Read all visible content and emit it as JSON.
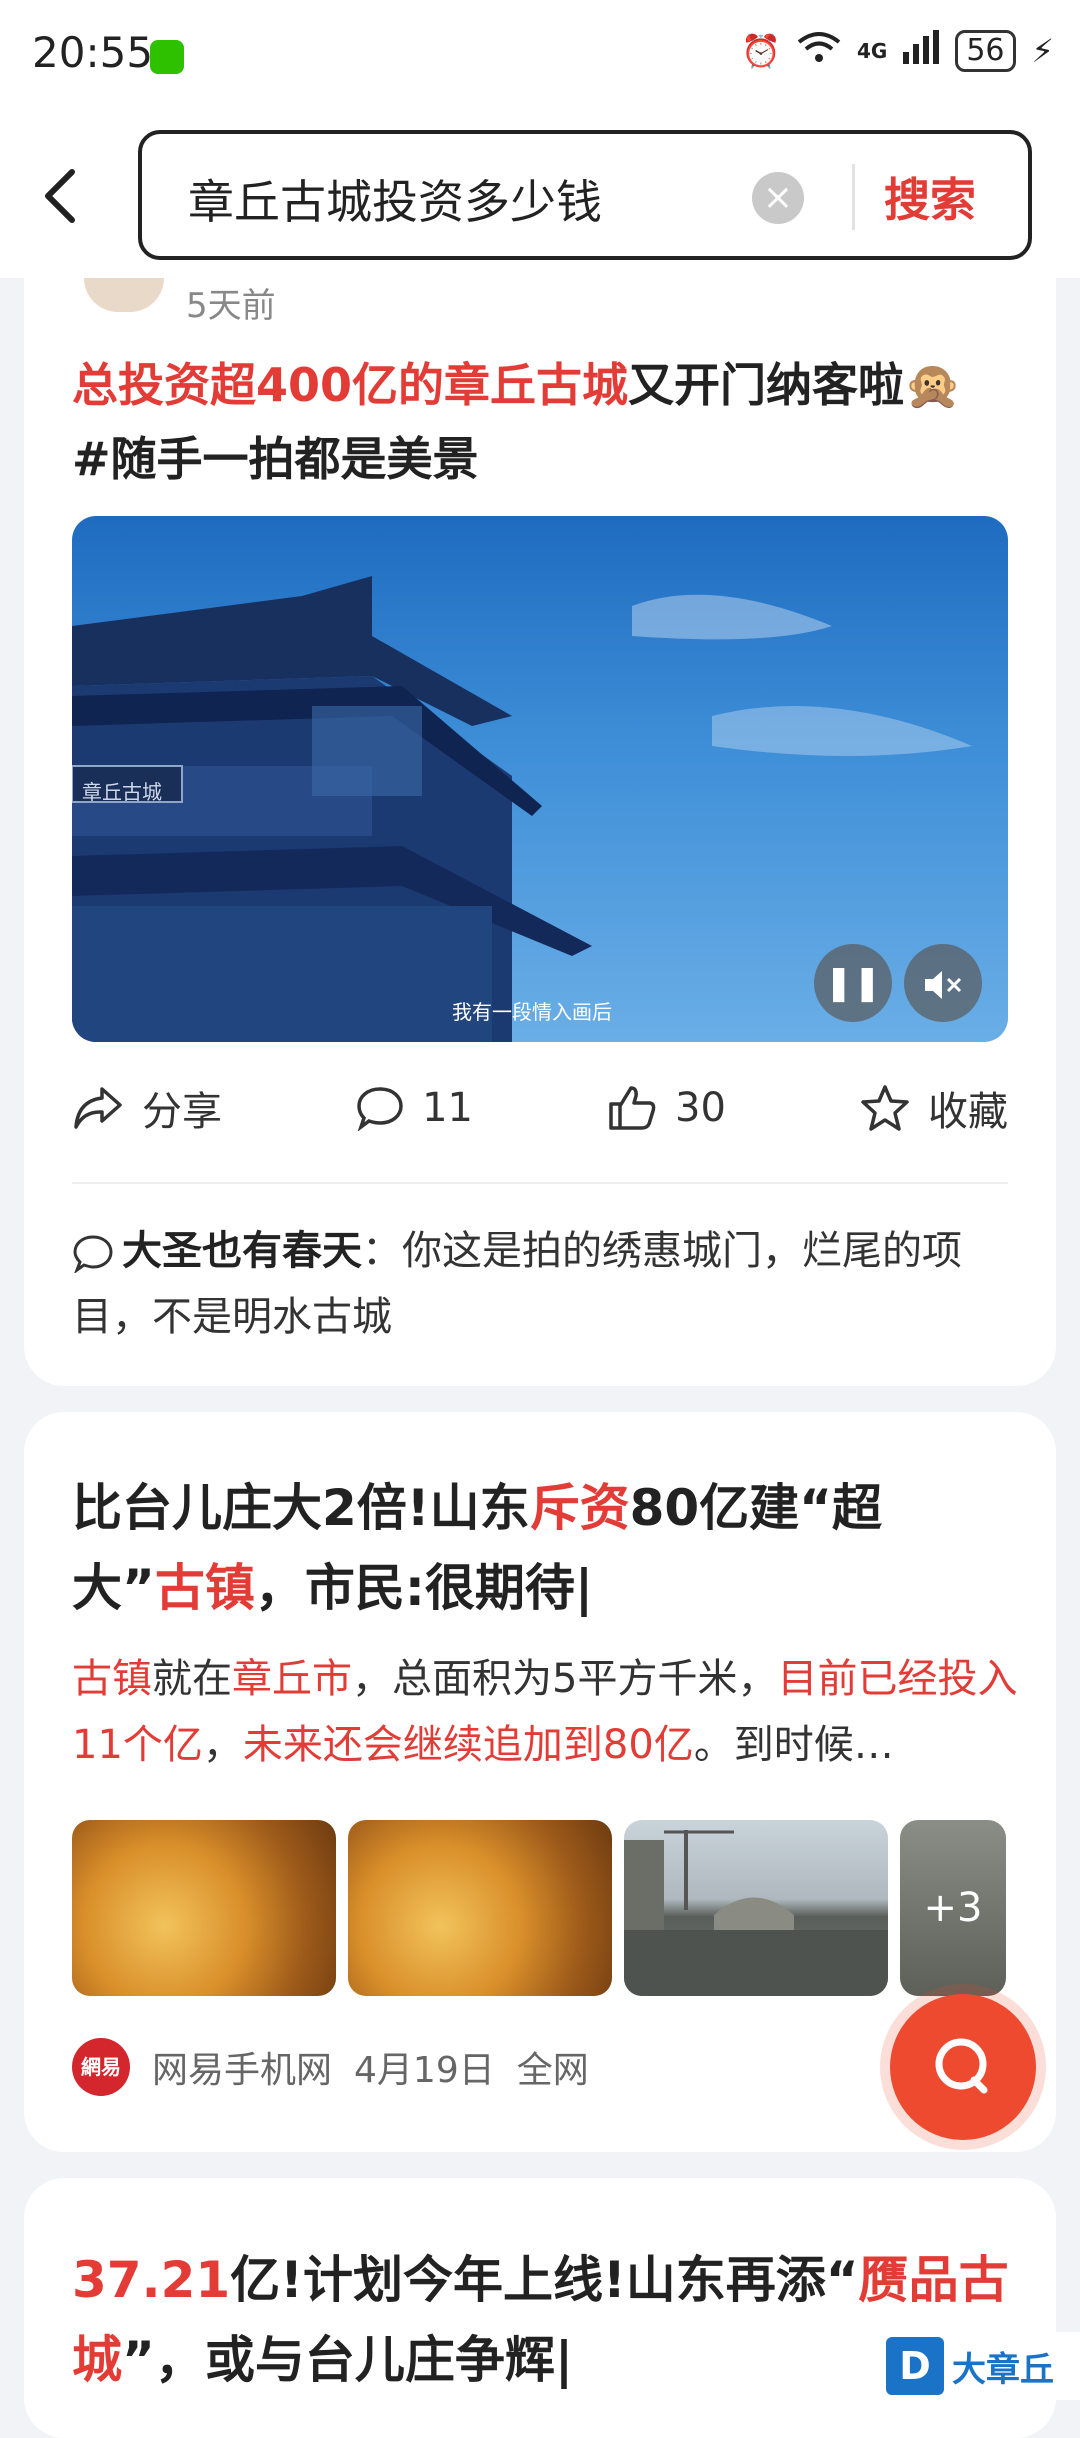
{
  "status_bar": {
    "time": "20:55",
    "network": "4G",
    "battery": "56"
  },
  "search": {
    "query": "章丘古城投资多少钱",
    "clear": "×",
    "button_label": "搜索"
  },
  "card1": {
    "time_ago": "5天前",
    "title_highlight": "总投资超400亿的章丘古城",
    "title_rest": "又开门纳客啦🙊",
    "title_line2": "#随手一拍都是美景",
    "video_caption": "我有一段情入画后",
    "video_sign": "章丘古城",
    "actions": {
      "share": "分享",
      "comments": "11",
      "likes": "30",
      "collect": "收藏"
    },
    "comment_user": "大圣也有春天",
    "comment_sep": "：",
    "comment_text": "你这是拍的绣惠城门，烂尾的项目，不是明水古城"
  },
  "card2": {
    "title_a": "比台儿庄大2倍!山东",
    "title_b": "斥资",
    "title_c": "80亿建“超大”",
    "title_d": "古镇",
    "title_e": "，市民:很期待|",
    "desc_a": "古镇",
    "desc_b": "就在",
    "desc_c": "章丘市",
    "desc_d": "，总面积为5平方千米，",
    "desc_e": "目前已经投入11个亿",
    "desc_f": "，",
    "desc_g": "未来还会继续追加到80亿",
    "desc_h": "。到时候…",
    "more_count": "+3",
    "source_logo": "網易",
    "source": "网易手机网",
    "date": "4月19日",
    "scope": "全网"
  },
  "card3": {
    "title_a": "37.21",
    "title_b": "亿!计划今年上线!山东再添“",
    "title_c": "赝品古城",
    "title_d": "”，或与台儿庄争辉|"
  },
  "watermark": {
    "logo": "D",
    "text": "大章丘"
  },
  "colors": {
    "accent": "#e33b36",
    "fab": "#ee4a2f"
  }
}
